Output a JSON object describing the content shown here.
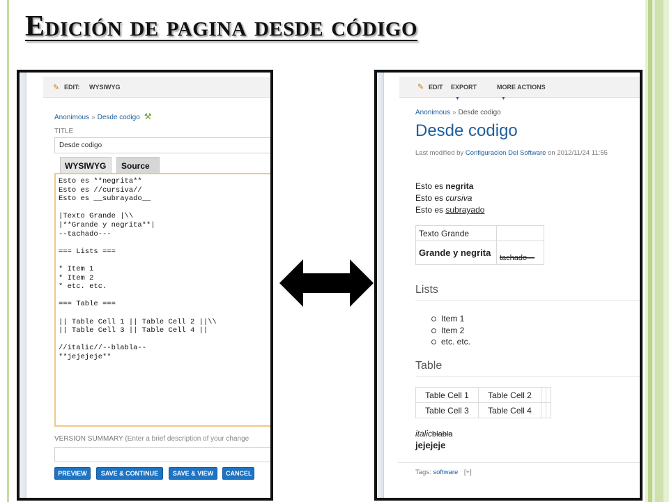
{
  "slide": {
    "title": "Edición de pagina desde código"
  },
  "editor": {
    "topbar_label": "EDIT:",
    "topbar_mode": "WYSIWYG",
    "breadcrumb": {
      "root": "Anonimous",
      "separator": "»",
      "current": "Desde codigo"
    },
    "title_label": "TITLE",
    "title_value": "Desde codigo",
    "tabs": [
      "WYSIWYG",
      "Source"
    ],
    "source_text": "Esto es **negrita**\nEsto es //cursiva//\nEsto es __subrayado__\n\n|Texto Grande |\\\\\n|**Grande y negrita**|\n--tachado---\n\n=== Lists ===\n\n* Item 1\n* Item 2\n* etc. etc.\n\n=== Table ===\n\n|| Table Cell 1 || Table Cell 2 ||\\\\\n|| Table Cell 3 || Table Cell 4 ||\n\n//italic//--blabla--\n**jejejeje**",
    "version_summary_label": "VERSION SUMMARY",
    "version_summary_hint": "(Enter a brief description of your change",
    "buttons": [
      "PREVIEW",
      "SAVE & CONTINUE",
      "SAVE & VIEW",
      "CANCEL"
    ]
  },
  "view": {
    "menu": [
      "EDIT",
      "EXPORT",
      "MORE ACTIONS"
    ],
    "breadcrumb": {
      "root": "Anonimous",
      "separator": "»",
      "current": "Desde codigo"
    },
    "page_title": "Desde codigo",
    "last_modified": {
      "prefix": "Last modified by",
      "author": "Configuracion Del Software",
      "suffix": "on 2012/11/24 11:55"
    },
    "lines": [
      {
        "prefix": "Esto es",
        "styled": "negrita"
      },
      {
        "prefix": "Esto es",
        "styled": "cursiva"
      },
      {
        "prefix": "Esto es",
        "styled": "subrayado"
      }
    ],
    "format_table": {
      "r1c1": "Texto Grande",
      "r2c1": "Grande y negrita",
      "r2c2": "tachado—"
    },
    "lists_heading": "Lists",
    "list_items": [
      "Item 1",
      "Item 2",
      "etc. etc."
    ],
    "table_heading": "Table",
    "table_cells": [
      "Table Cell 1",
      "Table Cell 2",
      "Table Cell 3",
      "Table Cell 4"
    ],
    "italic_text": "italic",
    "strike_text": "blabla",
    "bold_text": "jejejeje",
    "tags_label": "Tags:",
    "tag": "software",
    "tag_add": "[+]"
  }
}
